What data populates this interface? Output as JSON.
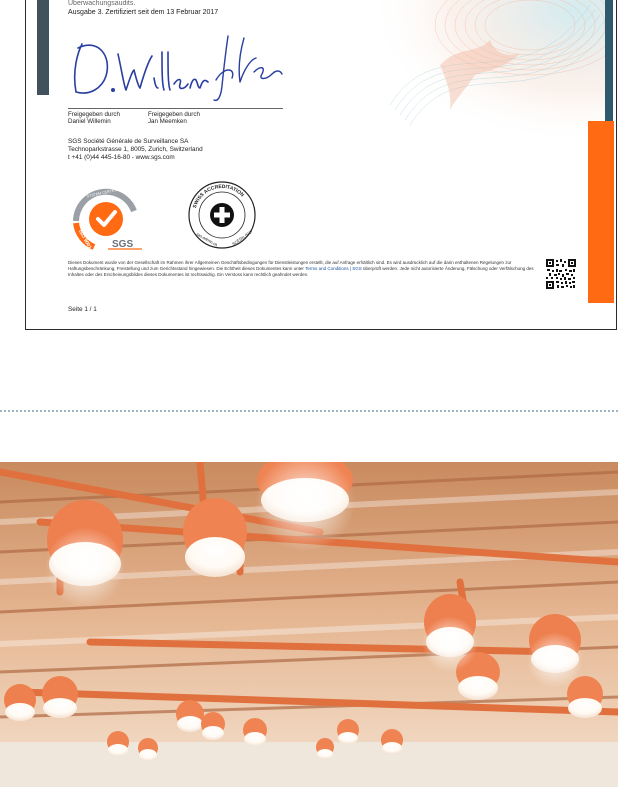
{
  "certificate": {
    "audit_line_1": "Überwachungsaudits.",
    "audit_line_2": "Ausgabe 3. Zertifiziert seit dem 13 Februar 2017",
    "signer1_role": "Freigegeben durch",
    "signer1_name": "Daniel Willemin",
    "signer2_role": "Freigegeben durch",
    "signer2_name": "Jan Meemken",
    "company_name": "SGS Société Générale de Surveillance SA",
    "company_address": "Technoparkstrasse 1, 8005, Zurich, Switzerland",
    "company_contact": "t +41 (0)44 445-16-80 - www.sgs.com",
    "iso_badge": {
      "top_text": "SYSTEM CERTIFICATION",
      "side_text": "ISO 9001",
      "brand": "SGS",
      "color": "#ff6a13"
    },
    "accreditation_badge": {
      "ring_text": "SWISS ACCREDITATION",
      "bottom_left": "sas.admin.ch",
      "bottom_right": "SCESm 0017"
    },
    "disclaimer_1": "Dieses Dokument wurde von der Gesellschaft im Rahmen ihrer Allgemeinen Geschäftsbedingungen für Dienstleistungen erstellt, die auf Anfrage erhältlich sind. Es wird ausdrücklich auf die darin",
    "disclaimer_2": "enthaltenen Regelungen zur Haftungsbeschränkung, Freistellung und zum Gerichtsstand hingewiesen. Die Echtheit dieses Dokumentes kann unter",
    "disclaimer_link": "Terms and Conditions | SGS",
    "disclaimer_3": "überprüft werden.",
    "disclaimer_4": "Jede nicht autorisierte Änderung, Fälschung oder Verfälschung des Inhaltes oder des Erscheinungsbildes dieses Dokumentes ist rechtswidrig. Ein Verstoss kann rechtlich geahndet werden.",
    "page_number": "Seite 1 / 1",
    "accent_color": "#ff6a13",
    "stripe_color": "#41525c"
  },
  "photo": {
    "icon": "ceiling-lamps-image"
  }
}
